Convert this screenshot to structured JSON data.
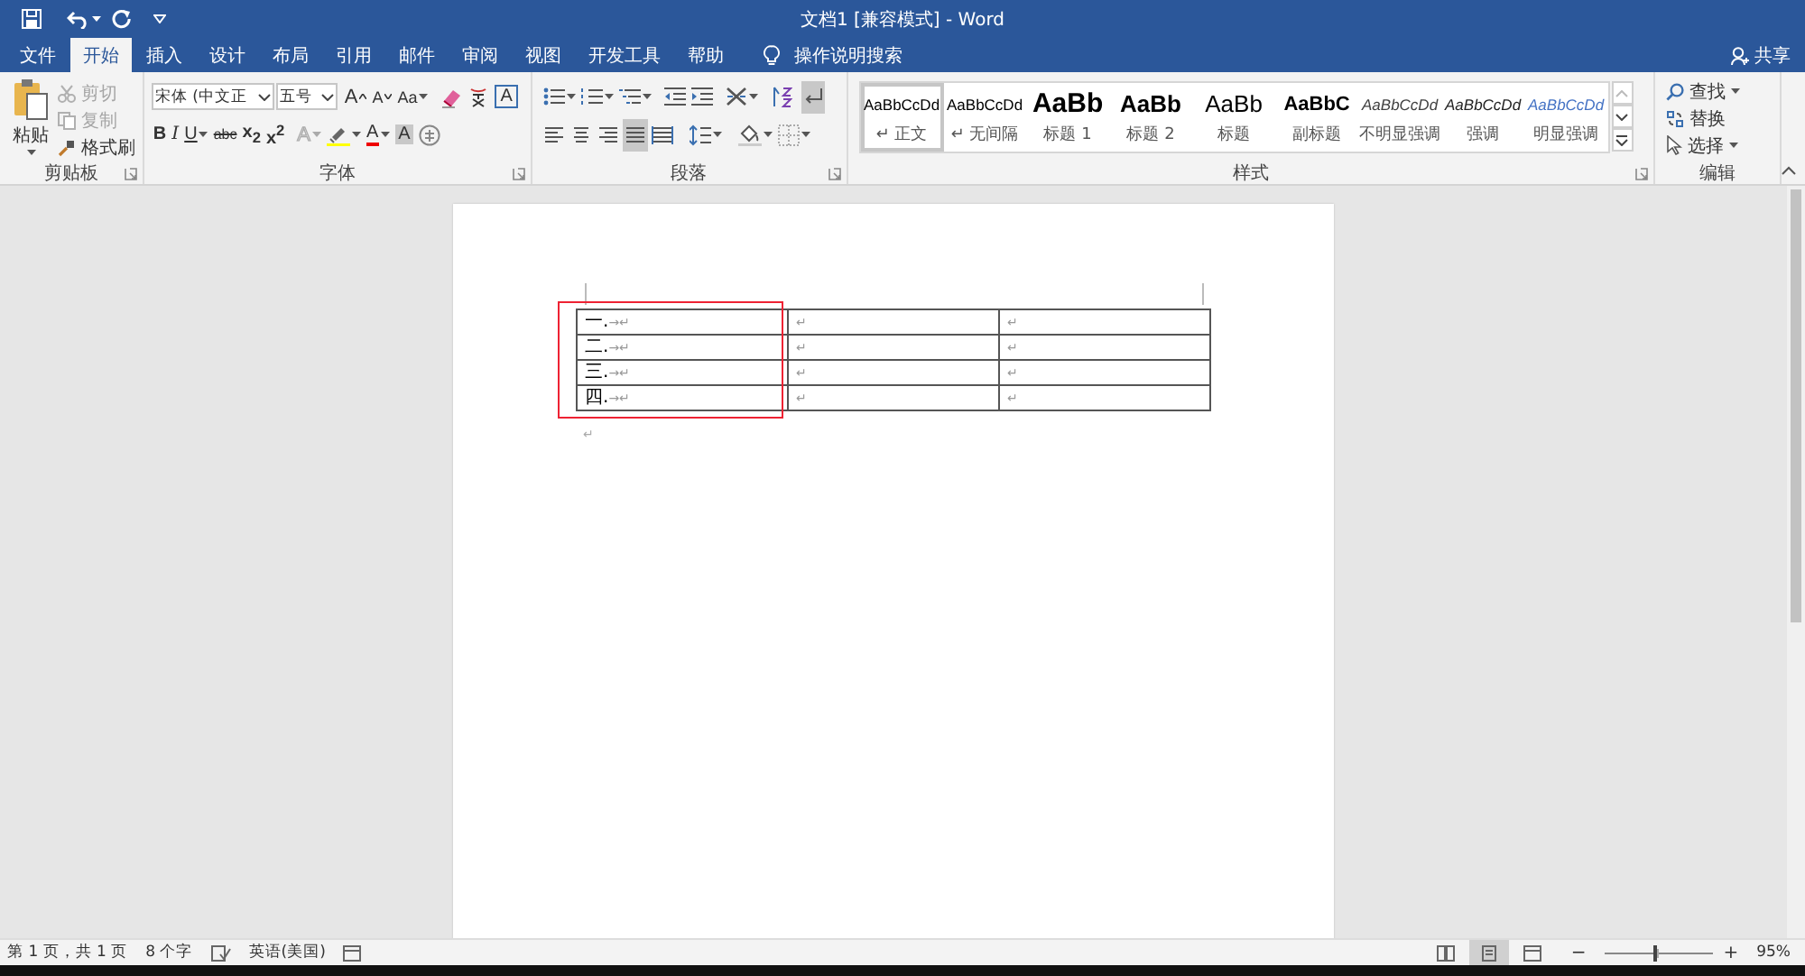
{
  "window": {
    "title": "文档1 [兼容模式] - Word"
  },
  "tabs": [
    {
      "label": "文件",
      "selected": false
    },
    {
      "label": "开始",
      "selected": true
    },
    {
      "label": "插入",
      "selected": false
    },
    {
      "label": "设计",
      "selected": false
    },
    {
      "label": "布局",
      "selected": false
    },
    {
      "label": "引用",
      "selected": false
    },
    {
      "label": "邮件",
      "selected": false
    },
    {
      "label": "审阅",
      "selected": false
    },
    {
      "label": "视图",
      "selected": false
    },
    {
      "label": "开发工具",
      "selected": false
    },
    {
      "label": "帮助",
      "selected": false
    }
  ],
  "tell_me": {
    "placeholder": "操作说明搜索"
  },
  "share": "共享",
  "clipboard": {
    "label": "剪贴板",
    "paste": "粘贴",
    "cut": {
      "label": "剪切",
      "disabled": true
    },
    "copy": {
      "label": "复制",
      "disabled": true
    },
    "format_painter": {
      "label": "格式刷",
      "disabled": false
    }
  },
  "font": {
    "label": "字体",
    "font_name": "宋体 (中文正",
    "font_size": "五号",
    "row1": [
      {
        "kind": "grow",
        "glyph": "A"
      },
      {
        "kind": "shrink",
        "glyph": "A"
      },
      {
        "kind": "case",
        "glyph": "Aa"
      },
      {
        "kind": "clear"
      },
      {
        "kind": "phonetic"
      },
      {
        "kind": "border",
        "glyph": "A"
      }
    ],
    "row2": [
      {
        "kind": "bold",
        "glyph": "B"
      },
      {
        "kind": "italic",
        "glyph": "I"
      },
      {
        "kind": "underline",
        "glyph": "U"
      },
      {
        "kind": "strike",
        "glyph": "abc"
      },
      {
        "kind": "sub",
        "glyph": "x$_{2}$"
      },
      {
        "kind": "sup",
        "glyph": "x$^{2}$"
      },
      {
        "kind": "effects",
        "glyph": "A"
      },
      {
        "kind": "highlight"
      },
      {
        "kind": "color",
        "glyph": "A"
      },
      {
        "kind": "shading",
        "glyph": "A"
      },
      {
        "kind": "enclose"
      }
    ]
  },
  "paragraph": {
    "label": "段落",
    "show_marks": {
      "on": true
    },
    "align": [
      {
        "selected": false
      },
      {
        "selected": false
      },
      {
        "selected": false
      },
      {
        "selected": true
      },
      {
        "selected": false
      }
    ]
  },
  "styles": {
    "label": "样式",
    "items": [
      {
        "kind": "normal",
        "sample": "AaBbCcDd",
        "name": "正文",
        "mark": "↵",
        "selected": true
      },
      {
        "kind": "nospacing",
        "sample": "AaBbCcDd",
        "name": "无间隔",
        "mark": "↵",
        "selected": false
      },
      {
        "kind": "heading1",
        "sample": "AaBb",
        "name": "标题 1",
        "selected": false
      },
      {
        "kind": "heading2",
        "sample": "AaBb",
        "name": "标题 2",
        "selected": false
      },
      {
        "kind": "title",
        "sample": "AaBb",
        "name": "标题",
        "selected": false
      },
      {
        "kind": "subtitle",
        "sample": "AaBbC",
        "name": "副标题",
        "selected": false
      },
      {
        "kind": "subtle",
        "sample": "AaBbCcDd",
        "name": "不明显强调",
        "selected": false
      },
      {
        "kind": "emphasis",
        "sample": "AaBbCcDd",
        "name": "强调",
        "selected": false
      },
      {
        "kind": "intense",
        "sample": "AaBbCcDd",
        "name": "明显强调",
        "selected": false
      }
    ]
  },
  "editing": {
    "label": "编辑",
    "find": "查找",
    "replace": "替换",
    "select": "选择"
  },
  "document": {
    "table": {
      "rows": [
        [
          {
            "text": "一.",
            "marks": "→↵"
          },
          {
            "marks": "↵"
          },
          {
            "marks": "↵"
          }
        ],
        [
          {
            "text": "二.",
            "marks": "→↵"
          },
          {
            "marks": "↵"
          },
          {
            "marks": "↵"
          }
        ],
        [
          {
            "text": "三.",
            "marks": "→↵"
          },
          {
            "marks": "↵"
          },
          {
            "marks": "↵"
          }
        ],
        [
          {
            "text": "四.",
            "marks": "→↵"
          },
          {
            "marks": "↵"
          },
          {
            "marks": "↵"
          }
        ]
      ]
    },
    "after_table": "↵"
  },
  "status_bar": {
    "page": "第 1 页，共 1 页",
    "words": "8 个字",
    "language": "英语(美国)",
    "views": [
      {
        "selected": false
      },
      {
        "selected": true
      },
      {
        "selected": false
      }
    ],
    "zoom_out": "−",
    "zoom_in": "+",
    "zoom": {
      "level": 0.47
    },
    "zoom_text": "95%"
  }
}
